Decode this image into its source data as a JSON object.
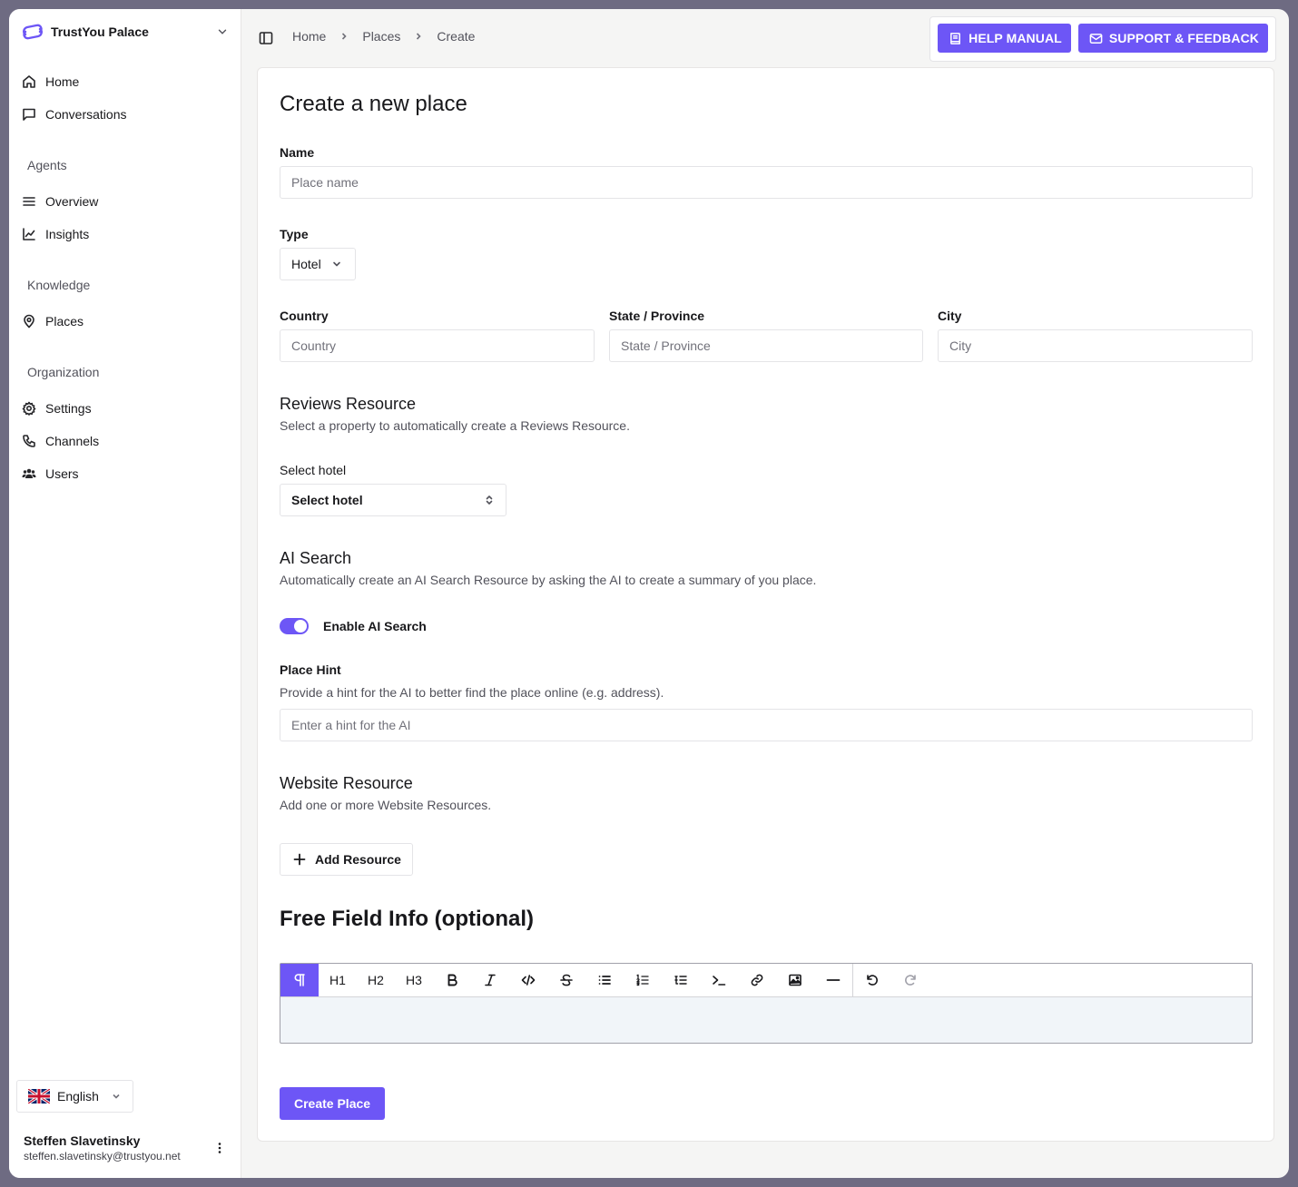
{
  "sidebar": {
    "org_name": "TrustYou Palace",
    "nav": {
      "home": "Home",
      "conversations": "Conversations",
      "agents_group": "Agents",
      "overview": "Overview",
      "insights": "Insights",
      "knowledge_group": "Knowledge",
      "places": "Places",
      "organization_group": "Organization",
      "settings": "Settings",
      "channels": "Channels",
      "users": "Users"
    },
    "language": "English",
    "user": {
      "name": "Steffen Slavetinsky",
      "email": "steffen.slavetinsky@trustyou.net"
    }
  },
  "topbar": {
    "breadcrumbs": [
      "Home",
      "Places",
      "Create"
    ],
    "help_manual": "HELP MANUAL",
    "support_feedback": "SUPPORT & FEEDBACK"
  },
  "form": {
    "title": "Create a new place",
    "name": {
      "label": "Name",
      "placeholder": "Place name"
    },
    "type": {
      "label": "Type",
      "value": "Hotel"
    },
    "country": {
      "label": "Country",
      "placeholder": "Country"
    },
    "state": {
      "label": "State / Province",
      "placeholder": "State / Province"
    },
    "city": {
      "label": "City",
      "placeholder": "City"
    },
    "reviews": {
      "heading": "Reviews Resource",
      "description": "Select a property to automatically create a Reviews Resource.",
      "select_label": "Select hotel",
      "select_value": "Select hotel"
    },
    "ai_search": {
      "heading": "AI Search",
      "description": "Automatically create an AI Search Resource by asking the AI to create a summary of you place.",
      "toggle_label": "Enable AI Search",
      "enabled": true,
      "hint_label": "Place Hint",
      "hint_description": "Provide a hint for the AI to better find the place online (e.g. address).",
      "hint_placeholder": "Enter a hint for the AI"
    },
    "website": {
      "heading": "Website Resource",
      "description": "Add one or more Website Resources.",
      "add_button": "Add Resource"
    },
    "free_field": {
      "heading": "Free Field Info (optional)",
      "toolbar": {
        "h1": "H1",
        "h2": "H2",
        "h3": "H3"
      }
    },
    "submit": "Create Place"
  },
  "colors": {
    "accent": "#6d56f6",
    "background": "#f5f5f4"
  }
}
